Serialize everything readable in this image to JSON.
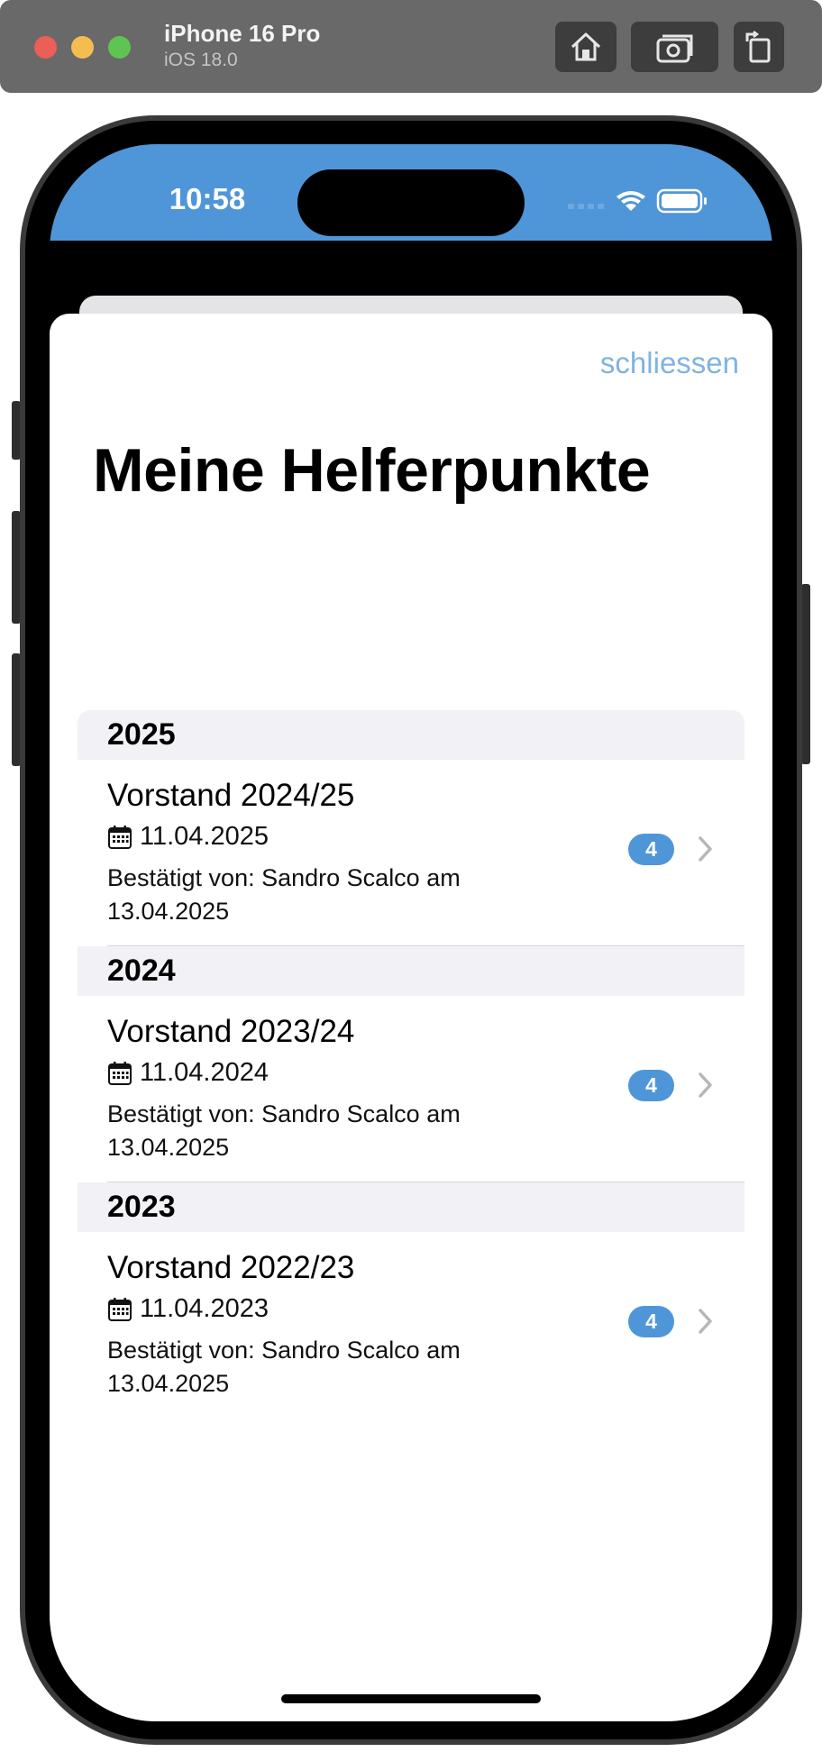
{
  "simulator": {
    "device_name": "iPhone 16 Pro",
    "os_version": "iOS 18.0",
    "home_icon": "home-icon",
    "screenshot_icon": "camera-icon",
    "rotate_icon": "rotate-icon"
  },
  "status_bar": {
    "time": "10:58",
    "wifi_icon": "wifi-icon",
    "battery_icon": "battery-icon",
    "color": "#4f96d8"
  },
  "sheet": {
    "close_label": "schliessen",
    "title": "Meine Helferpunkte"
  },
  "sections": [
    {
      "year": "2025",
      "items": [
        {
          "title": "Vorstand 2024/25",
          "date": "11.04.2025",
          "confirmed": "Bestätigt von: Sandro Scalco am 13.04.2025",
          "points": "4"
        }
      ]
    },
    {
      "year": "2024",
      "items": [
        {
          "title": "Vorstand 2023/24",
          "date": "11.04.2024",
          "confirmed": "Bestätigt von: Sandro Scalco am 13.04.2025",
          "points": "4"
        }
      ]
    },
    {
      "year": "2023",
      "items": [
        {
          "title": "Vorstand 2022/23",
          "date": "11.04.2023",
          "confirmed": "Bestätigt von: Sandro Scalco am 13.04.2025",
          "points": "4"
        }
      ]
    }
  ],
  "colors": {
    "accent": "#4f96d8",
    "close_link": "#7fb3e4",
    "section_bg": "#f2f2f6"
  }
}
